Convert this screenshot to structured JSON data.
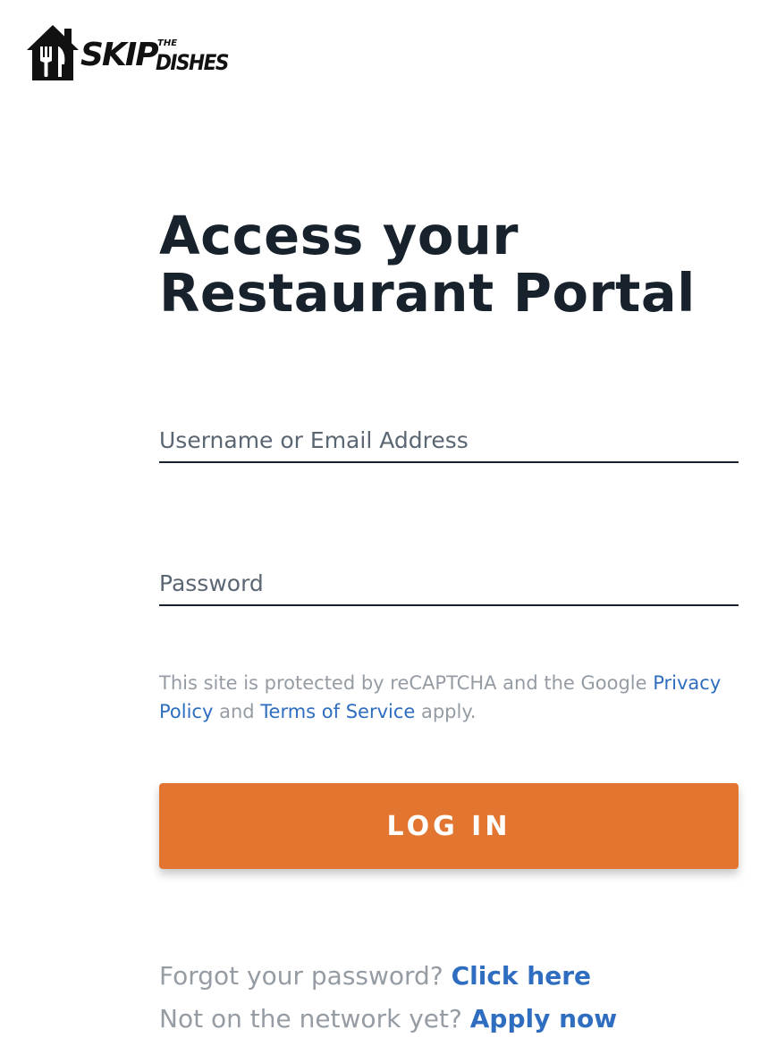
{
  "brand": {
    "name_skip": "SKIP",
    "name_the": "THE",
    "name_dishes": "DISHES"
  },
  "title": {
    "line1": "Access your",
    "line2": "Restaurant Portal"
  },
  "form": {
    "username_placeholder": "Username or Email Address",
    "password_placeholder": "Password",
    "username_value": "",
    "password_value": ""
  },
  "recaptcha": {
    "text_before": "This site is protected by reCAPTCHA and the Google ",
    "privacy_link": "Privacy Policy",
    "text_and": " and ",
    "terms_link": "Terms of Service",
    "text_after": " apply."
  },
  "login_button": {
    "label": "LOG IN"
  },
  "footer": {
    "forgot_text": "Forgot your password? ",
    "forgot_link": "Click here",
    "network_text": "Not on the network yet? ",
    "network_link": "Apply now"
  },
  "colors": {
    "accent": "#e2752f",
    "link": "#2e6dbf",
    "title": "#18222c",
    "muted": "#959ca4"
  },
  "icons": {
    "logo": "house-with-fork-knife-icon"
  }
}
